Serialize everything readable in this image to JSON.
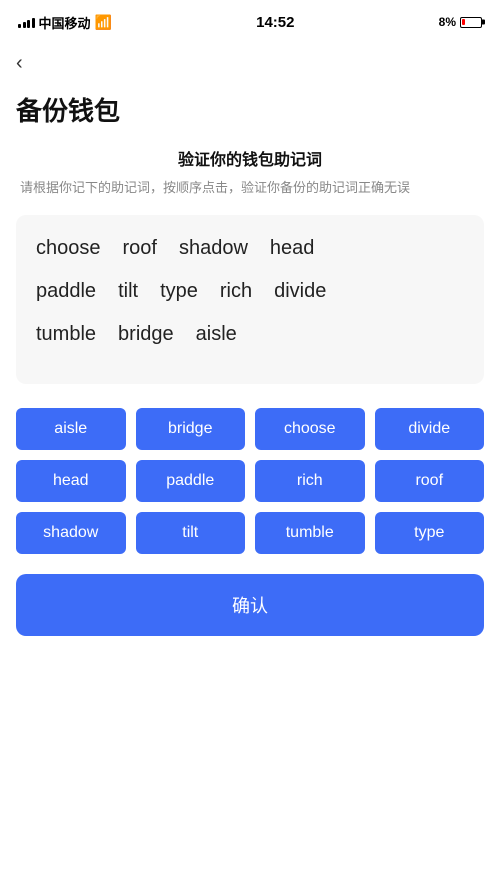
{
  "statusBar": {
    "carrier": "中国移动",
    "time": "14:52",
    "battery_pct": "8%"
  },
  "nav": {
    "back_label": "‹"
  },
  "page": {
    "title": "备份钱包"
  },
  "verify": {
    "title": "验证你的钱包助记词",
    "desc": "请根据你记下的助记词，按顺序点击，验证你备份的助记词正确无误"
  },
  "display_words": [
    {
      "word": "choose"
    },
    {
      "word": "roof"
    },
    {
      "word": "shadow"
    },
    {
      "word": "head"
    },
    {
      "word": "paddle"
    },
    {
      "word": "tilt"
    },
    {
      "word": "type"
    },
    {
      "word": "rich"
    },
    {
      "word": "divide"
    },
    {
      "word": "tumble"
    },
    {
      "word": "bridge"
    },
    {
      "word": "aisle"
    }
  ],
  "selectable_words": [
    "aisle",
    "bridge",
    "choose",
    "divide",
    "head",
    "paddle",
    "rich",
    "roof",
    "shadow",
    "tilt",
    "tumble",
    "type"
  ],
  "confirm_btn_label": "确认",
  "accent_color": "#3d6cf7"
}
